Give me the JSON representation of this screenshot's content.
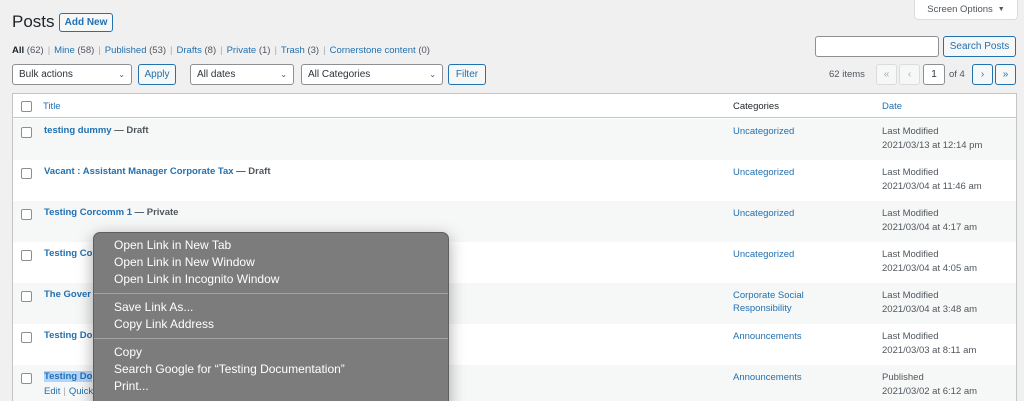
{
  "header": {
    "title": "Posts",
    "add_new": "Add New",
    "screen_options": "Screen Options",
    "screen_options_arrow": "▼"
  },
  "filters": [
    {
      "label": "All",
      "count": "(62)"
    },
    {
      "label": "Mine",
      "count": "(58)"
    },
    {
      "label": "Published",
      "count": "(53)"
    },
    {
      "label": "Drafts",
      "count": "(8)"
    },
    {
      "label": "Private",
      "count": "(1)"
    },
    {
      "label": "Trash",
      "count": "(3)"
    },
    {
      "label": "Cornerstone content",
      "count": "(0)"
    }
  ],
  "search": {
    "value": "",
    "button": "Search Posts"
  },
  "toolbar": {
    "bulk_actions": "Bulk actions",
    "apply": "Apply",
    "all_dates": "All dates",
    "all_categories": "All Categories",
    "filter": "Filter"
  },
  "pagination": {
    "count": "62 items",
    "first": "«",
    "prev": "‹",
    "current": "1",
    "of": "of 4",
    "next": "›",
    "last": "»"
  },
  "table": {
    "headers": {
      "title": "Title",
      "categories": "Categories",
      "date": "Date"
    },
    "rows": [
      {
        "title": "testing dummy",
        "state": " — Draft",
        "category": "Uncategorized",
        "date_status": "Last Modified",
        "date": "2021/03/13 at 12:14 pm"
      },
      {
        "title": "Vacant : Assistant Manager Corporate Tax",
        "state": " — Draft",
        "category": "Uncategorized",
        "date_status": "Last Modified",
        "date": "2021/03/04 at 11:46 am"
      },
      {
        "title": "Testing Corcomm 1",
        "state": " — Private",
        "category": "Uncategorized",
        "date_status": "Last Modified",
        "date": "2021/03/04 at 4:17 am"
      },
      {
        "title": "Testing Co",
        "state": "",
        "category": "Uncategorized",
        "date_status": "Last Modified",
        "date": "2021/03/04 at 4:05 am"
      },
      {
        "title": "The Gover",
        "state": "",
        "category": "Corporate Social Responsibility",
        "date_status": "Last Modified",
        "date": "2021/03/04 at 3:48 am"
      },
      {
        "title": "Testing Do",
        "state": "",
        "category": "Announcements",
        "date_status": "Last Modified",
        "date": "2021/03/03 at 8:11 am"
      },
      {
        "title": "Testing Do",
        "state": "",
        "category": "Announcements",
        "date_status": "Published",
        "date": "2021/03/02 at 6:12 am"
      }
    ],
    "row_actions": {
      "edit": "Edit",
      "quick": "Quick"
    }
  },
  "context_menu": {
    "open_new_tab": "Open Link in New Tab",
    "open_new_window": "Open Link in New Window",
    "open_incognito": "Open Link in Incognito Window",
    "save_link_as": "Save Link As...",
    "copy_link_address": "Copy Link Address",
    "copy": "Copy",
    "search_google": "Search Google for “Testing Documentation”",
    "print": "Print..."
  }
}
